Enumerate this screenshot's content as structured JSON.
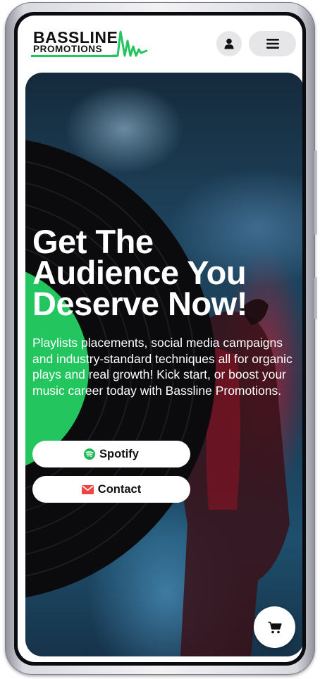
{
  "brand": {
    "name_line1": "BASSLINE",
    "name_line2": "PROMOTIONS",
    "accent_color": "#22c55e"
  },
  "header": {
    "account_icon": "user-icon",
    "menu_icon": "hamburger-menu-icon"
  },
  "hero": {
    "title_line1": "Get The",
    "title_line2": "Audience You",
    "title_line3": "Deserve Now!",
    "description": "Playlists placements, social media campaigns and industry-standard techniques all for organic plays and real growth! Kick start, or boost your music career today with Bassline Promotions.",
    "buttons": [
      {
        "label": "Spotify",
        "icon": "spotify-icon",
        "icon_color": "#1DB954"
      },
      {
        "label": "Contact",
        "icon": "envelope-icon",
        "icon_color": "#ef4444"
      }
    ]
  },
  "cart": {
    "icon": "shopping-cart-icon"
  }
}
